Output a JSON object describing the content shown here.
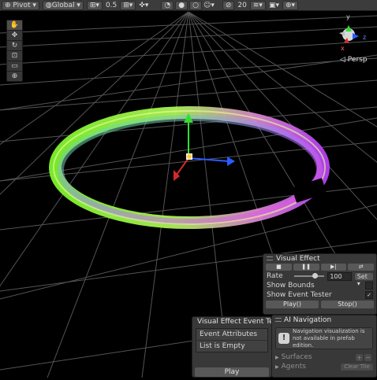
{
  "toolbar": {
    "pivot": "Pivot",
    "space": "Global",
    "snap_value": "0.5",
    "layer_count": "20"
  },
  "scene": {
    "view_label": "Persp",
    "gizmo_y": "y",
    "gizmo_x": "x",
    "gizmo_z": "z",
    "colors": {
      "ring_green": "#7cff2a",
      "ring_magenta": "#d64bff",
      "grid": "#4d4d4d",
      "axis_x": "#2b5cff",
      "axis_y": "#33dd33",
      "axis_z": "#d22b2b"
    }
  },
  "tools": [
    "hand-icon",
    "move-icon",
    "rotate-icon",
    "scale-icon",
    "rect-icon",
    "transform-icon"
  ],
  "visual_effect": {
    "title": "Visual Effect",
    "controls": [
      "■",
      "❚❚",
      "▶|",
      "⇄"
    ],
    "rate_label": "Rate",
    "rate_value": "100",
    "rate_fraction": 0.6,
    "set_label": "Set ▾",
    "show_bounds": "Show Bounds",
    "show_bounds_checked": false,
    "show_event_tester": "Show Event Tester",
    "show_event_tester_checked": true,
    "play_label": "Play()",
    "stop_label": "Stop()"
  },
  "event_tester": {
    "title": "Visual Effect Event Tes",
    "items": [
      "Event Attributes",
      "List is Empty"
    ],
    "play_label": "Play"
  },
  "ai_navigation": {
    "title": "AI Navigation",
    "message": "Navigation visualization is not available in prefab edition.",
    "surfaces": "Surfaces",
    "agents": "Agents",
    "clear_label": "Clear Tile"
  }
}
